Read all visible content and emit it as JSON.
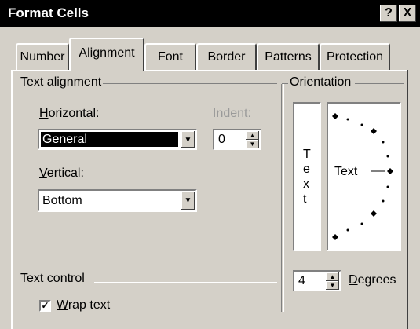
{
  "window": {
    "title": "Format Cells",
    "help_label": "?",
    "close_label": "X"
  },
  "tabs": [
    "Number",
    "Alignment",
    "Font",
    "Border",
    "Patterns",
    "Protection"
  ],
  "active_tab": "Alignment",
  "text_alignment": {
    "group_label": "Text alignment",
    "horizontal_label": "Horizontal:",
    "horizontal_value": "General",
    "indent_label": "Indent:",
    "indent_value": "0",
    "vertical_label": "Vertical:",
    "vertical_value": "Bottom"
  },
  "orientation": {
    "group_label": "Orientation",
    "vertical_text": [
      "T",
      "e",
      "x",
      "t"
    ],
    "dial_text": "Text",
    "degrees_value": "4",
    "degrees_label": "Degrees"
  },
  "text_control": {
    "group_label": "Text control",
    "wrap_text_label": "Wrap text",
    "wrap_text_checked": true
  },
  "icons": {
    "dropdown": "chevron-down-icon",
    "spin_up": "spin-up-icon",
    "spin_down": "spin-down-icon",
    "check": "checkmark-icon"
  }
}
